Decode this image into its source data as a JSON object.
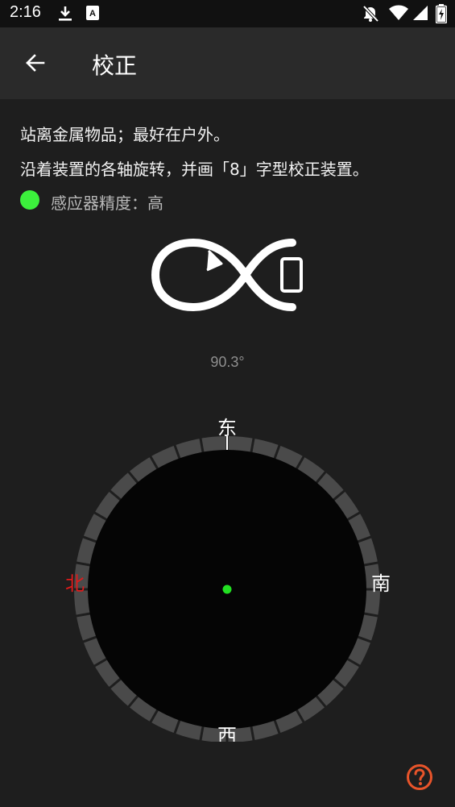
{
  "status_bar": {
    "time": "2:16",
    "left_icons": [
      "download-icon",
      "text-notification-icon"
    ],
    "right_icons": [
      "notifications-off-icon",
      "wifi-icon",
      "signal-icon",
      "battery-charging-icon"
    ]
  },
  "app_bar": {
    "title": "校正",
    "back_icon": "arrow-back-icon"
  },
  "instructions": {
    "line1": "站离金属物品；最好在户外。",
    "line2": "沿着装置的各轴旋转，并画「8」字型校正装置。"
  },
  "accuracy": {
    "label": "感应器精度：高",
    "indicator_color": "#3cf03c"
  },
  "heading": {
    "value": "90.3°"
  },
  "compass": {
    "north": "北",
    "east": "东",
    "south": "南",
    "west": "西",
    "north_color": "#e01b1b",
    "center_dot_color": "#22e022"
  },
  "help": {
    "icon": "help-circle-icon",
    "color": "#e8542a"
  }
}
